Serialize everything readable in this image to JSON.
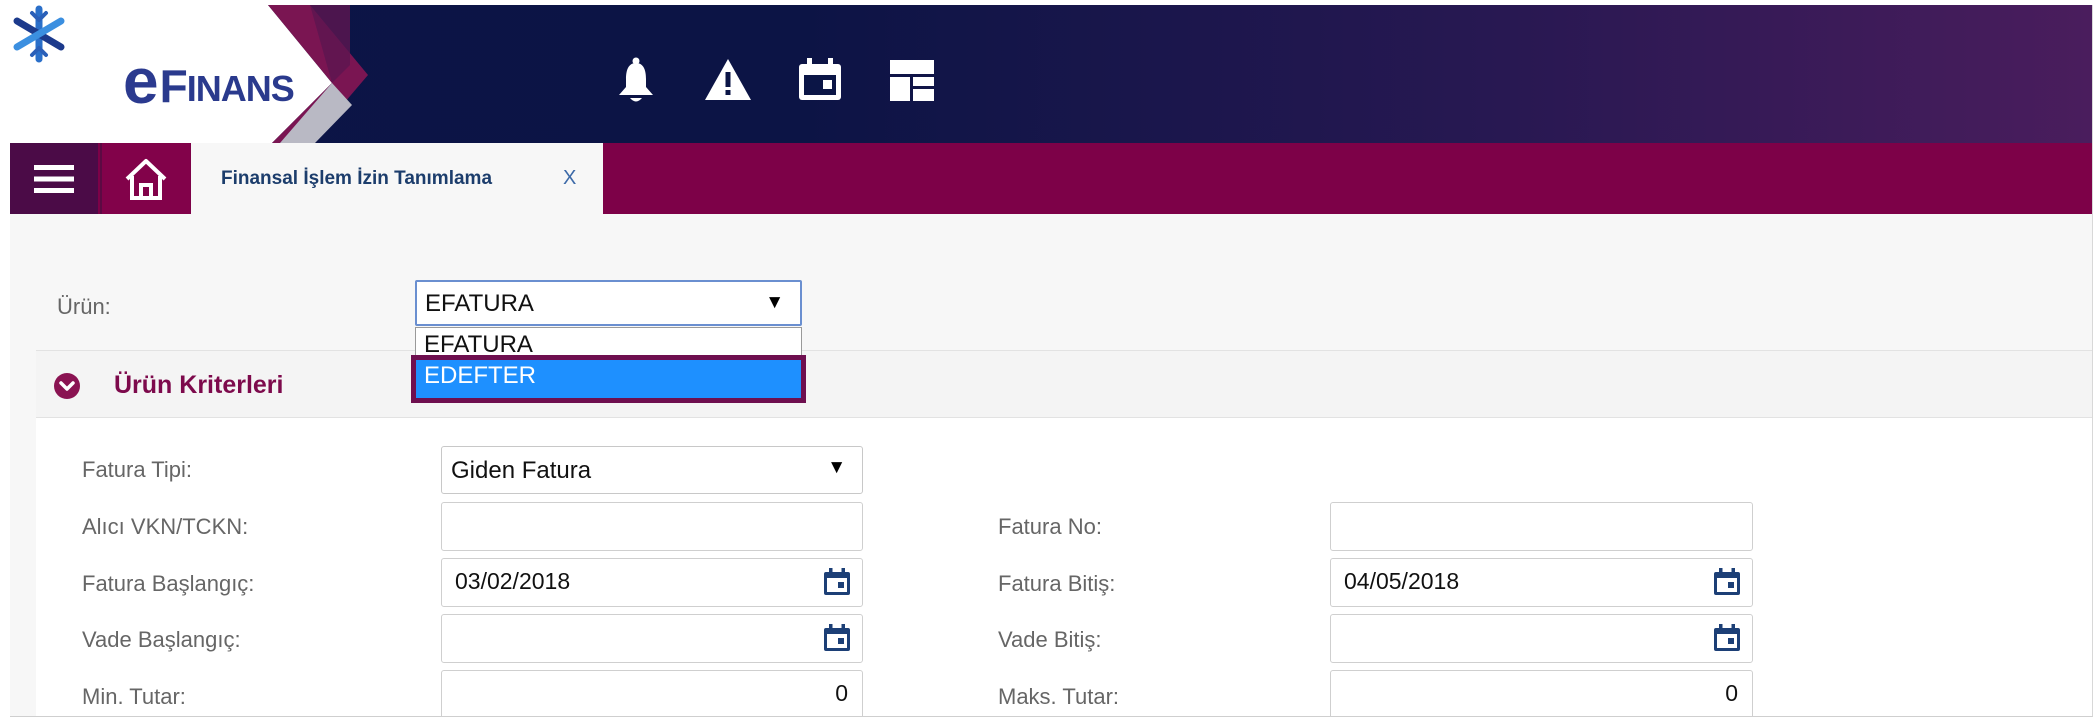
{
  "header": {
    "logo_e": "e",
    "logo_f": "F",
    "logo_rest": "INANS",
    "icons": [
      "bell-icon",
      "warning-icon",
      "calendar-icon",
      "dashboard-icon"
    ]
  },
  "tabbar": {
    "menu_icon": "hamburger-icon",
    "home_icon": "home-icon",
    "tab_label": "Finansal İşlem İzin Tanımlama",
    "tab_close": "X"
  },
  "form": {
    "urun_label": "Ürün:",
    "urun_value": "EFATURA",
    "dropdown_options": [
      "EFATURA",
      "EDEFTER"
    ],
    "dropdown_highlighted": "EDEFTER",
    "panel_title": "Ürün Kriterleri",
    "fatura_tipi_label": "Fatura Tipi:",
    "fatura_tipi_value": "Giden Fatura",
    "alici_label": "Alıcı VKN/TCKN:",
    "alici_value": "",
    "fatura_no_label": "Fatura No:",
    "fatura_no_value": "",
    "fatura_baslangic_label": "Fatura Başlangıç:",
    "fatura_baslangic_value": "03/02/2018",
    "fatura_bitis_label": "Fatura Bitiş:",
    "fatura_bitis_value": "04/05/2018",
    "vade_baslangic_label": "Vade Başlangıç:",
    "vade_baslangic_value": "",
    "vade_bitis_label": "Vade Bitiş:",
    "vade_bitis_value": "",
    "min_tutar_label": "Min. Tutar:",
    "min_tutar_value": "0",
    "maks_tutar_label": "Maks. Tutar:",
    "maks_tutar_value": "0",
    "arrow_glyph": "▼"
  },
  "colors": {
    "header_dark": "#0b1546",
    "tabbar": "#7d0148",
    "accent": "#7d0a4c",
    "selection": "#1e90ff"
  }
}
